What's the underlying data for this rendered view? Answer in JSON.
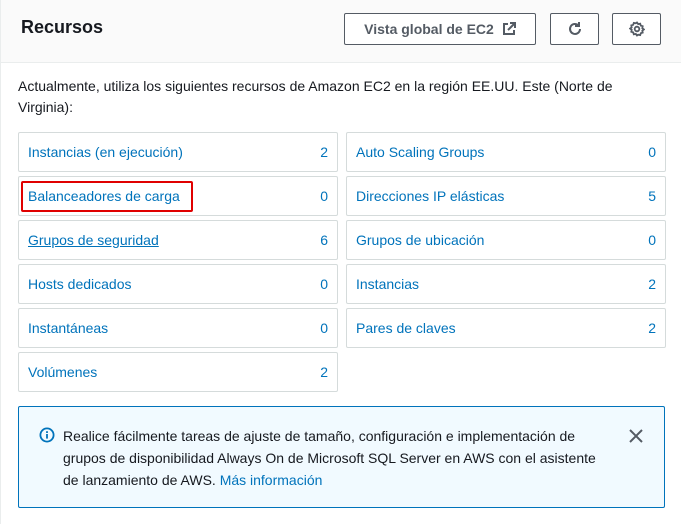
{
  "header": {
    "title": "Recursos",
    "global_view_label": "Vista global de EC2"
  },
  "description": "Actualmente, utiliza los siguientes recursos de Amazon EC2 en la región EE.UU. Este (Norte de Virginia):",
  "resources": {
    "left": [
      {
        "label": "Instancias (en ejecución)",
        "count": "2"
      },
      {
        "label": "Balanceadores de carga",
        "count": "0"
      },
      {
        "label": "Grupos de seguridad",
        "count": "6"
      },
      {
        "label": "Hosts dedicados",
        "count": "0"
      },
      {
        "label": "Instantáneas",
        "count": "0"
      },
      {
        "label": "Volúmenes",
        "count": "2"
      }
    ],
    "right": [
      {
        "label": "Auto Scaling Groups",
        "count": "0"
      },
      {
        "label": "Direcciones IP elásticas",
        "count": "5"
      },
      {
        "label": "Grupos de ubicación",
        "count": "0"
      },
      {
        "label": "Instancias",
        "count": "2"
      },
      {
        "label": "Pares de claves",
        "count": "2"
      }
    ]
  },
  "info": {
    "text": "Realice fácilmente tareas de ajuste de tamaño, configuración e implementación de grupos de disponibilidad Always On de Microsoft SQL Server en AWS con el asistente de lanzamiento de AWS.",
    "link": "Más información"
  },
  "icons": {
    "external": "external-link-icon",
    "refresh": "refresh-icon",
    "settings": "gear-icon",
    "info": "info-icon",
    "close": "close-icon"
  },
  "colors": {
    "link": "#0073bb",
    "highlight": "#e00000",
    "info_bg": "#f1faff"
  }
}
